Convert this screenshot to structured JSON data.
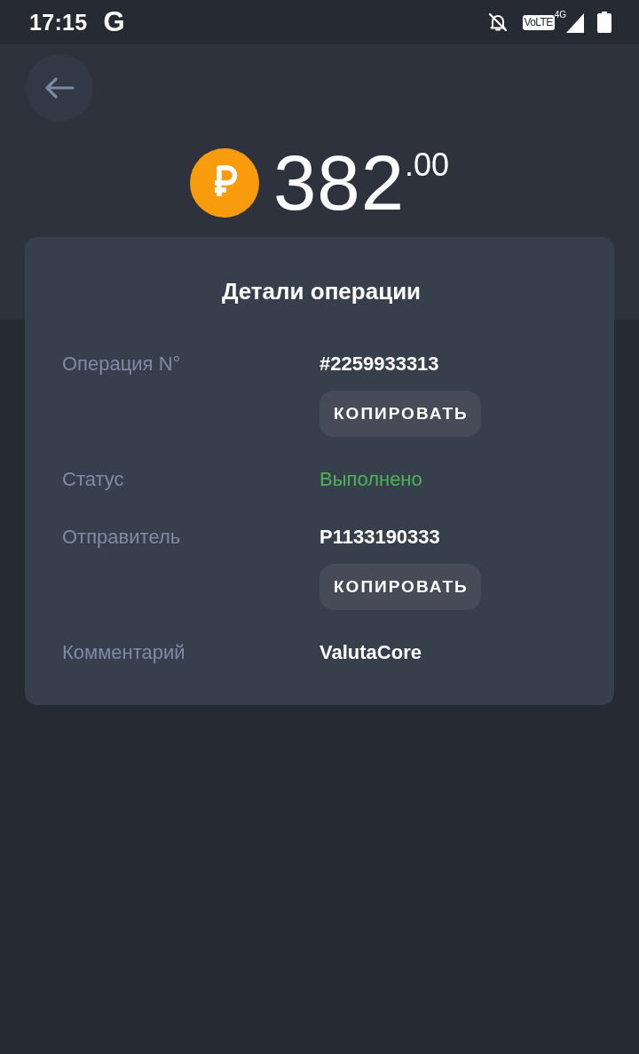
{
  "status_bar": {
    "time": "17:15",
    "app_letter": "G",
    "volte": "VoLTE",
    "network": "4G"
  },
  "header": {
    "amount": {
      "integer": "382",
      "fraction": ".00"
    }
  },
  "details": {
    "title": "Детали операции",
    "rows": [
      {
        "kind": "copyable",
        "label": "Операция N°",
        "value": "#2259933313",
        "action": "КОПИРОВАТЬ"
      },
      {
        "kind": "status",
        "label": "Статус",
        "value": "Выполнено"
      },
      {
        "kind": "copyable",
        "label": "Отправитель",
        "value": "P1133190333",
        "action": "КОПИРОВАТЬ"
      },
      {
        "kind": "plain",
        "label": "Комментарий",
        "value": "ValutaCore"
      }
    ]
  }
}
